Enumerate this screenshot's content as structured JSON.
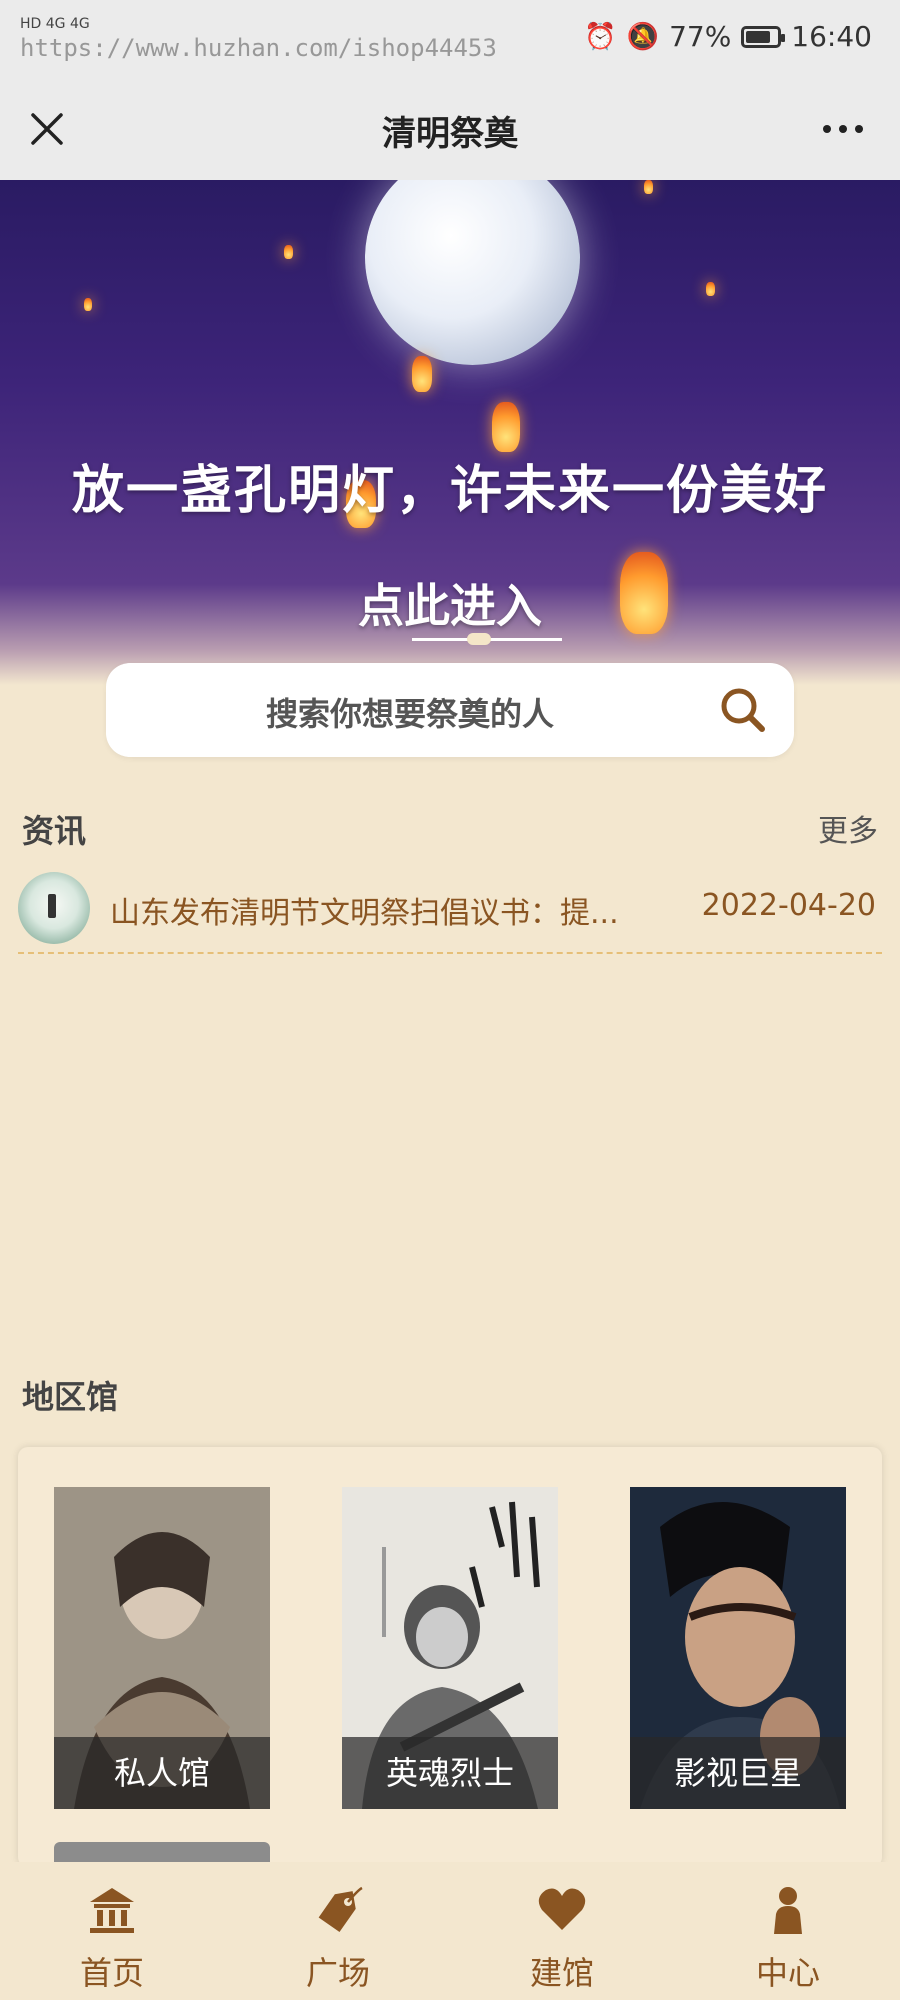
{
  "status_bar": {
    "left_text": "HD 4G 4G",
    "watermark": "https://www.huzhan.com/ishop44453",
    "battery_percent": "77%",
    "time": "16:40"
  },
  "navbar": {
    "title": "清明祭奠"
  },
  "banner": {
    "headline": "放一盏孔明灯，许未来一份美好",
    "enter_label": "点此进入"
  },
  "search": {
    "placeholder": "搜索你想要祭奠的人"
  },
  "news": {
    "section_title": "资讯",
    "more_label": "更多",
    "items": [
      {
        "title": "山东发布清明节文明祭扫倡议书：提...",
        "date": "2022-04-20"
      }
    ]
  },
  "regions": {
    "section_title": "地区馆",
    "halls": [
      {
        "label": "私人馆"
      },
      {
        "label": "英魂烈士"
      },
      {
        "label": "影视巨星"
      }
    ]
  },
  "tabbar": {
    "tabs": [
      {
        "label": "首页",
        "icon": "building-icon"
      },
      {
        "label": "广场",
        "icon": "tag-icon"
      },
      {
        "label": "建馆",
        "icon": "heart-icon"
      },
      {
        "label": "中心",
        "icon": "user-icon"
      }
    ],
    "accent_color": "#8a5522"
  }
}
